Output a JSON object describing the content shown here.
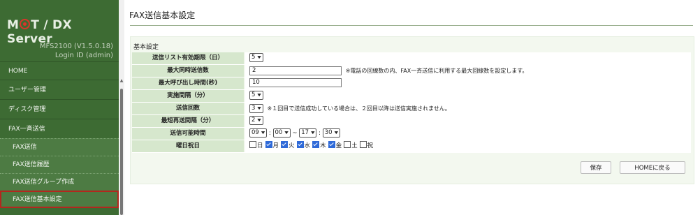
{
  "brand": {
    "logo_text": "M◎T / DX Server",
    "version": "MFS2100 (V1.5.0.18)",
    "login": "Login ID (admin)"
  },
  "menu": {
    "home": "HOME",
    "user_mgmt": "ユーザー管理",
    "disk_mgmt": "ディスク管理",
    "fax_broadcast": "FAX一斉送信",
    "sub": [
      "FAX送信",
      "FAX送信履歴",
      "FAX送信グループ作成",
      "FAX送信基本設定"
    ]
  },
  "page": {
    "title": "FAX送信基本設定",
    "section": "基本設定"
  },
  "form": {
    "list_expiry": {
      "label": "送信リスト有効期限（日）",
      "value": "5"
    },
    "max_concurrent": {
      "label": "最大同時送信数",
      "value": "2",
      "note": "※電話の回線数の内、FAX一斉送信に利用する最大回線数を設定します。"
    },
    "max_call_time": {
      "label": "最大呼び出し時間(秒)",
      "value": "10"
    },
    "interval": {
      "label": "実施間隔（分）",
      "value": "5"
    },
    "send_count": {
      "label": "送信回数",
      "value": "3",
      "note": "※１回目で送信成功している場合は、２回目以降は送信実施されません。"
    },
    "min_resend": {
      "label": "最短再送間隔（分）",
      "value": "2"
    },
    "send_hours": {
      "label": "送信可能時間",
      "start_h": "09",
      "start_m": "00",
      "end_h": "17",
      "end_m": "30",
      "sep": "~",
      "colon": ":"
    },
    "weekdays": {
      "label": "曜日祝日",
      "days": [
        {
          "name": "日",
          "checked": false
        },
        {
          "name": "月",
          "checked": true
        },
        {
          "name": "火",
          "checked": true
        },
        {
          "name": "水",
          "checked": true
        },
        {
          "name": "木",
          "checked": true
        },
        {
          "name": "金",
          "checked": true
        },
        {
          "name": "土",
          "checked": false
        },
        {
          "name": "祝",
          "checked": false
        }
      ]
    }
  },
  "buttons": {
    "save": "保存",
    "home": "HOMEに戻る"
  },
  "icons": {
    "scroll_up": "scroll-up-arrow-icon",
    "dropdown": "chevron-down-icon",
    "checkbox": "checkbox-icon"
  },
  "colors": {
    "sidebar": "#3d6b33",
    "submenu": "#4d7b43",
    "label_bg": "#d6e7cd",
    "panel_bg": "#f3f8ef",
    "active_outline": "#b3271e",
    "check": "#2f6ad8"
  }
}
